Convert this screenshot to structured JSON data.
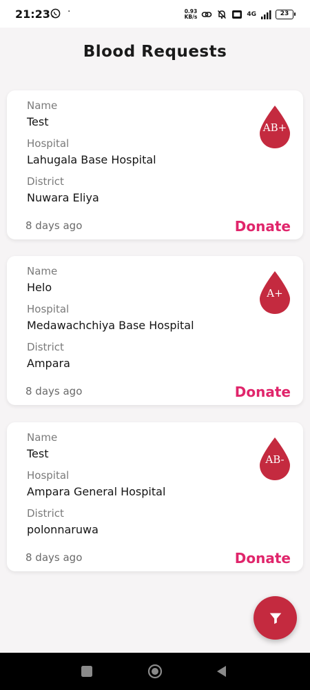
{
  "status_bar": {
    "time": "21:23",
    "dot": "·",
    "net_speed_value": "0.93",
    "net_speed_unit": "KB/s",
    "network": "4G",
    "battery": "23"
  },
  "page": {
    "title": "Blood Requests"
  },
  "labels": {
    "name": "Name",
    "hospital": "Hospital",
    "district": "District"
  },
  "requests": [
    {
      "name": "Test",
      "hospital": "Lahugala Base Hospital",
      "district": "Nuwara Eliya",
      "blood_group": "AB+",
      "time_ago": "8 days ago",
      "action": "Donate"
    },
    {
      "name": "Helo",
      "hospital": "Medawachchiya Base Hospital",
      "district": "Ampara",
      "blood_group": "A+",
      "time_ago": "8 days ago",
      "action": "Donate"
    },
    {
      "name": "Test",
      "hospital": "Ampara General Hospital",
      "district": "polonnaruwa",
      "blood_group": "AB-",
      "time_ago": "8 days ago",
      "action": "Donate"
    }
  ],
  "fab": {
    "icon": "filter-icon"
  },
  "colors": {
    "accent": "#e0256b",
    "drop": "#c42a3f",
    "fab": "#c42a3f",
    "background": "#f6f4f5"
  },
  "nav": {
    "icons": [
      "square-recents-icon",
      "circle-home-icon",
      "triangle-back-icon"
    ]
  }
}
